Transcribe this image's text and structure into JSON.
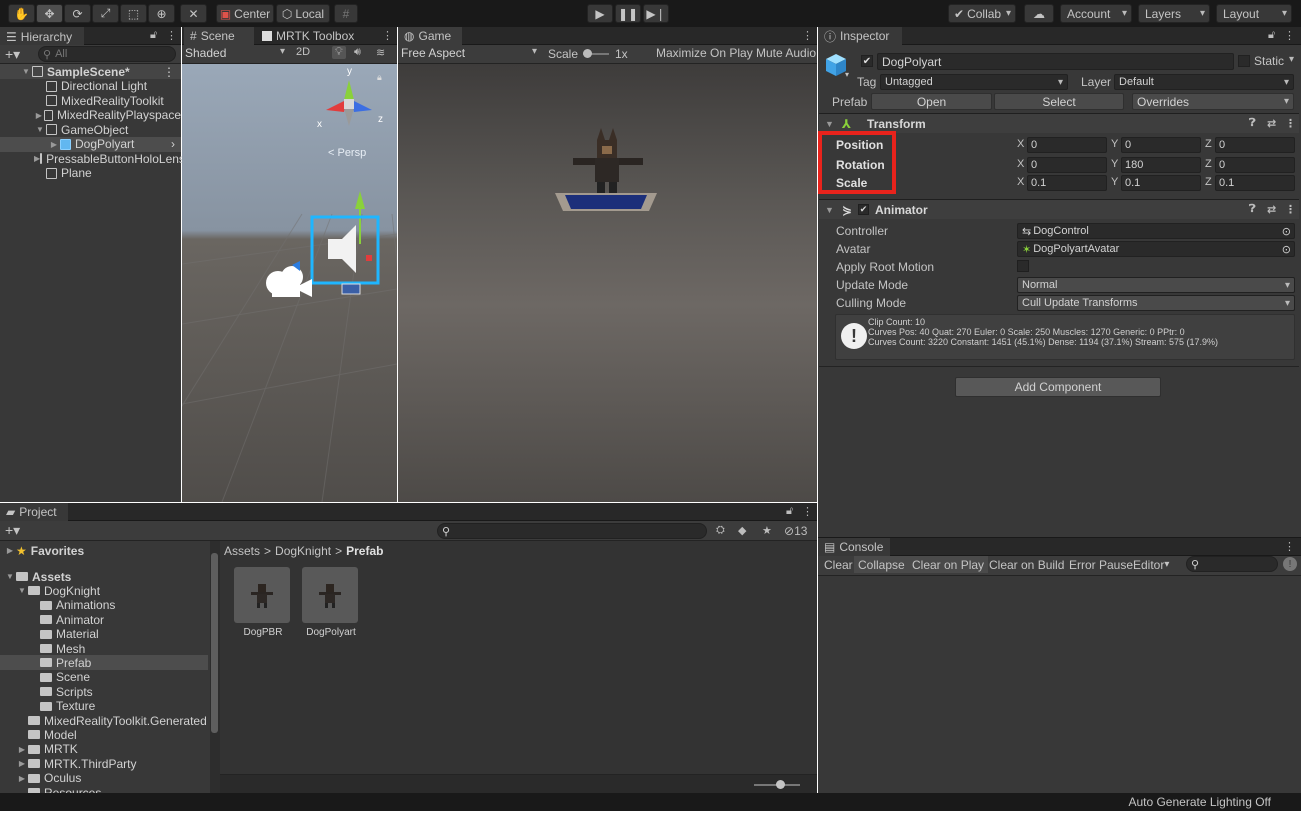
{
  "toolbar": {
    "pivot_label": "Center",
    "space_label": "Local",
    "collab_label": "Collab",
    "account_label": "Account",
    "layers_label": "Layers",
    "layout_label": "Layout"
  },
  "hierarchy": {
    "tab": "Hierarchy",
    "search_placeholder": "All",
    "items": [
      {
        "label": "SampleScene*",
        "indent": 0,
        "type": "scene"
      },
      {
        "label": "Directional Light",
        "indent": 1
      },
      {
        "label": "MixedRealityToolkit",
        "indent": 1
      },
      {
        "label": "MixedRealityPlayspace",
        "indent": 1,
        "collapsed": true
      },
      {
        "label": "GameObject",
        "indent": 1,
        "expanded": true
      },
      {
        "label": "DogPolyart",
        "indent": 2,
        "selected": true
      },
      {
        "label": "PressableButtonHoloLens2",
        "indent": 1,
        "collapsed": true
      },
      {
        "label": "Plane",
        "indent": 1
      }
    ]
  },
  "scene": {
    "tab": "Scene",
    "tab2": "MRTK Toolbox",
    "shading": "Shaded",
    "mode_2d": "2D",
    "persp_label": "< Persp",
    "gizmo_y": "y",
    "gizmo_x": "x",
    "gizmo_z": "z"
  },
  "game": {
    "tab": "Game",
    "aspect": "Free Aspect",
    "scale_label": "Scale",
    "scale_value": "1x",
    "maximize": "Maximize On Play",
    "mute": "Mute Audio"
  },
  "inspector": {
    "tab": "Inspector",
    "object_name": "DogPolyart",
    "static_label": "Static",
    "tag_label": "Tag",
    "tag_value": "Untagged",
    "layer_label": "Layer",
    "layer_value": "Default",
    "prefab_label": "Prefab",
    "prefab_open": "Open",
    "prefab_select": "Select",
    "prefab_overrides": "Overrides",
    "transform": {
      "title": "Transform",
      "position_label": "Position",
      "rotation_label": "Rotation",
      "scale_label": "Scale",
      "position": {
        "x": "0",
        "y": "0",
        "z": "0"
      },
      "rotation": {
        "x": "0",
        "y": "180",
        "z": "0"
      },
      "scale": {
        "x": "0.1",
        "y": "0.1",
        "z": "0.1"
      }
    },
    "animator": {
      "title": "Animator",
      "controller_label": "Controller",
      "controller_value": "DogControl",
      "avatar_label": "Avatar",
      "avatar_value": "DogPolyartAvatar",
      "root_motion_label": "Apply Root Motion",
      "update_mode_label": "Update Mode",
      "update_mode_value": "Normal",
      "culling_mode_label": "Culling Mode",
      "culling_mode_value": "Cull Update Transforms",
      "info_line1": "Clip Count: 10",
      "info_line2": "Curves Pos: 40 Quat: 270 Euler: 0 Scale: 250 Muscles: 1270 Generic: 0 PPtr: 0",
      "info_line3": "Curves Count: 3220 Constant: 1451 (45.1%) Dense: 1194 (37.1%) Stream: 575 (17.9%)"
    },
    "add_component": "Add Component"
  },
  "project": {
    "tab": "Project",
    "hidden_count": "13",
    "breadcrumb": [
      "Assets",
      "DogKnight",
      "Prefab"
    ],
    "tree": [
      {
        "label": "Favorites",
        "indent": 0,
        "type": "fav"
      },
      {
        "label": "Assets",
        "indent": 0,
        "type": "root"
      },
      {
        "label": "DogKnight",
        "indent": 1,
        "expanded": true
      },
      {
        "label": "Animations",
        "indent": 2
      },
      {
        "label": "Animator",
        "indent": 2
      },
      {
        "label": "Material",
        "indent": 2
      },
      {
        "label": "Mesh",
        "indent": 2
      },
      {
        "label": "Prefab",
        "indent": 2,
        "selected": true
      },
      {
        "label": "Scene",
        "indent": 2
      },
      {
        "label": "Scripts",
        "indent": 2
      },
      {
        "label": "Texture",
        "indent": 2
      },
      {
        "label": "MixedRealityToolkit.Generated",
        "indent": 1
      },
      {
        "label": "Model",
        "indent": 1
      },
      {
        "label": "MRTK",
        "indent": 1,
        "collapsed": true
      },
      {
        "label": "MRTK.ThirdParty",
        "indent": 1,
        "collapsed": true
      },
      {
        "label": "Oculus",
        "indent": 1,
        "collapsed": true
      },
      {
        "label": "Resources",
        "indent": 1
      }
    ],
    "assets": [
      "DogPBR",
      "DogPolyart"
    ]
  },
  "console": {
    "tab": "Console",
    "buttons": [
      "Clear",
      "Collapse",
      "Clear on Play",
      "Clear on Build",
      "Error Pause",
      "Editor"
    ]
  },
  "status": {
    "text": "Auto Generate Lighting Off"
  },
  "colors": {
    "highlight": "#e8231c",
    "accent": "#3a79bb",
    "selection": "#2c5d87"
  }
}
